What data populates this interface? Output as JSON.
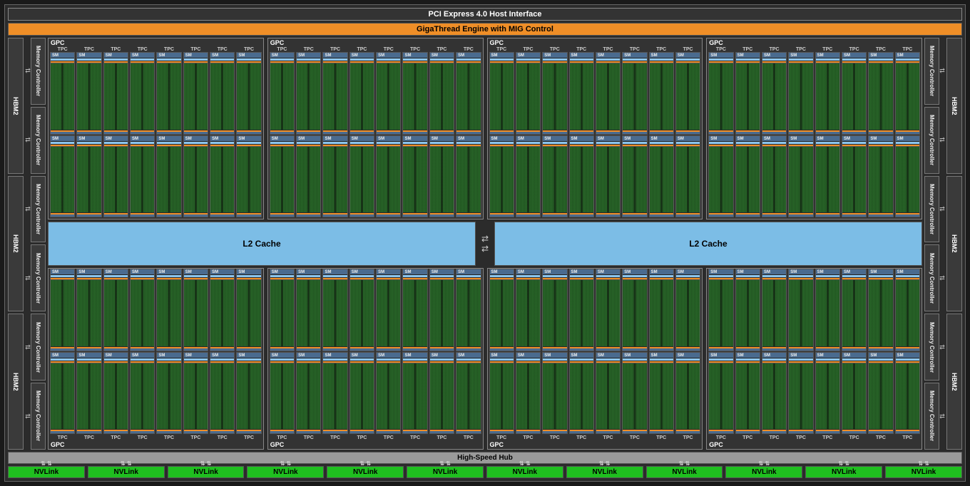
{
  "title": "PCI Express 4.0 Host Interface",
  "gt": "GigaThread Engine with MIG Control",
  "hbm": "HBM2",
  "mc": "Memory Controller",
  "gpc": "GPC",
  "tpc": "TPC",
  "sm": "SM",
  "l2": "L2 Cache",
  "hub": "High-Speed Hub",
  "nvlink": "NVLink",
  "structure": {
    "hbm_per_side": 3,
    "mc_per_side": 6,
    "gpc_count": 8,
    "tpc_per_gpc": 8,
    "sm_per_tpc": 2,
    "nvlink_count": 12,
    "l2_slices": 2
  },
  "colors": {
    "bg": "#2b2b2b",
    "orange": "#ef8e27",
    "blue": "#7cbde6",
    "green_sm": "#2a6b2a",
    "green_nv": "#1fbf1f",
    "gray": "#9a9a9a",
    "dark": "#333"
  }
}
